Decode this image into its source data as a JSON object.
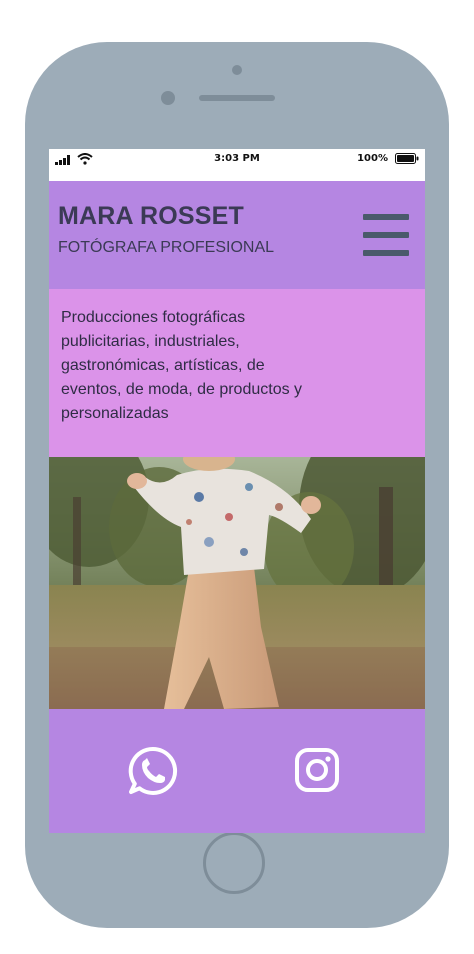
{
  "status_bar": {
    "time": "3:03 PM",
    "battery": "100%"
  },
  "header": {
    "title": "MARA ROSSET",
    "subtitle": "FOTÓGRAFA PROFESIONAL",
    "menu_icon": "hamburger-icon"
  },
  "intro": {
    "text": "Producciones fotográficas publicitarias, industriales, gastronómicas, artísticas, de eventos, de moda, de productos y personalizadas"
  },
  "hero_image": {
    "subject": "woman dancing in a park"
  },
  "footer": {
    "links": [
      {
        "icon": "whatsapp-icon"
      },
      {
        "icon": "instagram-icon"
      }
    ]
  },
  "colors": {
    "header_bg": "#b586e2",
    "intro_bg": "#db93e9",
    "text": "#3b3a55",
    "menu_icon": "#4a5a6b",
    "phone_frame": "#9dacb8"
  }
}
